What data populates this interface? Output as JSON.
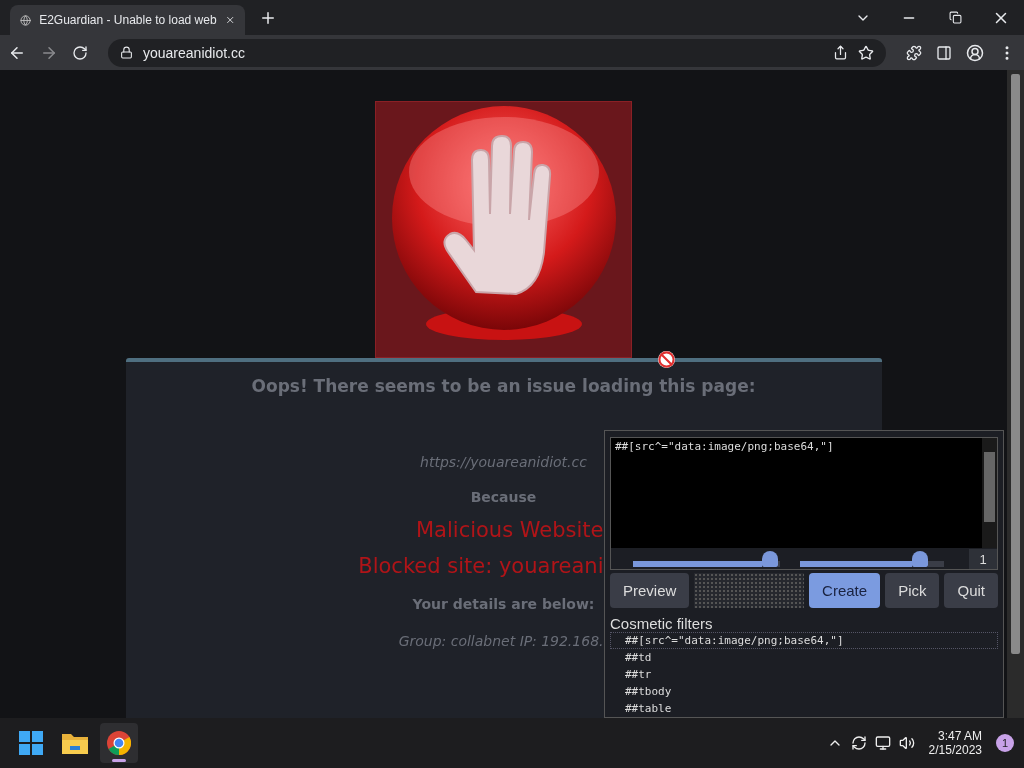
{
  "browser": {
    "tab": {
      "title": "E2Guardian - Unable to load web",
      "selected": true
    },
    "address": "youareanidiot.cc"
  },
  "page": {
    "message": [
      {
        "text": "Oops! There seems to be an issue loading this page:",
        "kind": "heading",
        "cut": false
      },
      {
        "text": "https://youareanidiot.cc",
        "kind": "url",
        "cut": false
      },
      {
        "text": "Because",
        "kind": "label",
        "cut": false
      },
      {
        "text": "Malicious Website",
        "kind": "reason",
        "cut": true
      },
      {
        "text": "Blocked site: youareani",
        "kind": "reason",
        "cut": true
      },
      {
        "text": "Your details are below:",
        "kind": "label",
        "cut": false
      },
      {
        "text": "Group: collabnet   IP: 192.168.",
        "kind": "detail",
        "cut": true
      }
    ]
  },
  "picker": {
    "filter_text": "##[src^=\"data:image/png;base64,\"]",
    "sliders": [
      {
        "level": 0.93
      },
      {
        "level": 0.83
      }
    ],
    "count": "1",
    "buttons": [
      {
        "label": "Preview",
        "kind": "secondary"
      },
      {
        "label": "Create",
        "kind": "primary"
      },
      {
        "label": "Pick",
        "kind": "secondary"
      },
      {
        "label": "Quit",
        "kind": "secondary"
      }
    ],
    "filters_title": "Cosmetic filters",
    "filters": [
      {
        "text": "##[src^=\"data:image/png;base64,\"]",
        "selected": true
      },
      {
        "text": "##td",
        "selected": false
      },
      {
        "text": "##tr",
        "selected": false
      },
      {
        "text": "##tbody",
        "selected": false
      },
      {
        "text": "##table",
        "selected": false
      }
    ]
  },
  "taskbar": {
    "apps": [
      {
        "kind": "start",
        "selected": false
      },
      {
        "kind": "folder",
        "selected": false
      },
      {
        "kind": "chrome",
        "selected": true
      }
    ],
    "time": "3:47 AM",
    "date": "2/15/2023",
    "notifications": "1"
  }
}
